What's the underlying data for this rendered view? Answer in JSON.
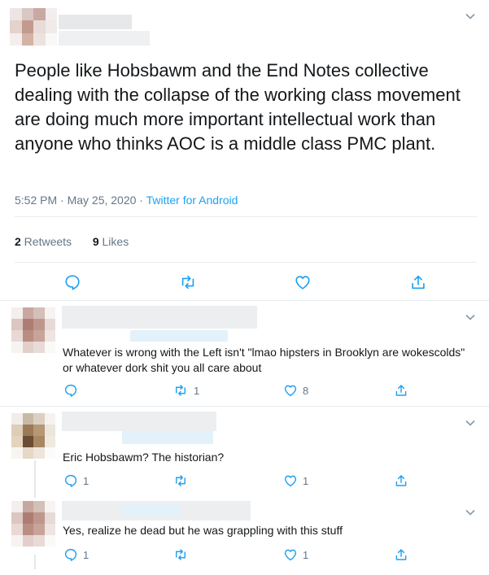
{
  "main_tweet": {
    "text": "People like Hobsbawm and the End Notes collective dealing with the collapse of the working class movement are doing much more important intellectual work than anyone who thinks AOC is a middle class PMC plant.",
    "time_date": "5:52 PM · May 25, 2020 · ",
    "source": "Twitter for Android",
    "retweets_count": "2",
    "retweets_label": " Retweets",
    "likes_count": "9",
    "likes_label": " Likes"
  },
  "replies": [
    {
      "text": "Whatever is wrong with the Left isn't \"lmao hipsters in Brooklyn are wokescolds\" or whatever dork shit you all care about",
      "reply_count": "",
      "retweet_count": "1",
      "like_count": "8"
    },
    {
      "text": "Eric Hobsbawm? The historian?",
      "reply_count": "1",
      "retweet_count": "",
      "like_count": "1"
    },
    {
      "text": "Yes, realize he dead but he was grappling with this stuff",
      "reply_count": "1",
      "retweet_count": "",
      "like_count": "1"
    }
  ],
  "icons": [
    "chevron-down-icon",
    "reply-icon",
    "retweet-icon",
    "like-icon",
    "share-icon"
  ],
  "colors": {
    "text": "#14171a",
    "secondary": "#657786",
    "link": "#1da1f2",
    "divider": "#e6ecf0",
    "icon": "#1da1f2"
  }
}
